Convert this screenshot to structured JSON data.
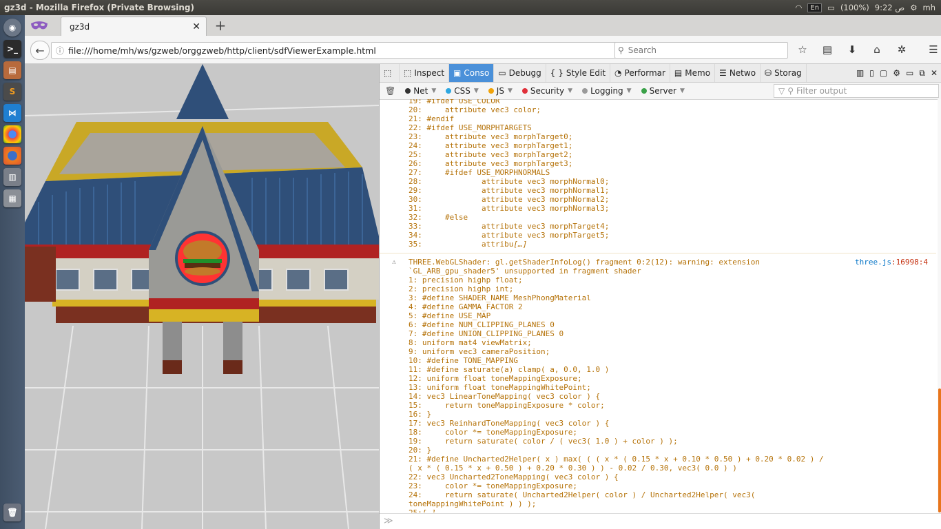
{
  "os": {
    "window_title": "gz3d - Mozilla Firefox (Private Browsing)",
    "tray": {
      "battery": "(100%)",
      "lang": "En",
      "time": "9:22 ص",
      "user": "mh"
    }
  },
  "launcher": {
    "items": [
      "dash",
      "terminal",
      "files",
      "sublime",
      "vscode",
      "chrome",
      "firefox",
      "text-editor",
      "settings",
      "trash"
    ]
  },
  "browser": {
    "tab_title": "gz3d",
    "url": "file:///home/mh/ws/gzweb/orggzweb/http/client/sdfViewerExample.html",
    "search_placeholder": "Search"
  },
  "devtools": {
    "tabs": [
      {
        "label": "Inspect",
        "icon": "⬚"
      },
      {
        "label": "Conso",
        "icon": "▣",
        "selected": true
      },
      {
        "label": "Debugg",
        "icon": "▭"
      },
      {
        "label": "Style Edit",
        "icon": "{ }"
      },
      {
        "label": "Performar",
        "icon": "◔"
      },
      {
        "label": "Memo",
        "icon": "▤"
      },
      {
        "label": "Netwo",
        "icon": "☰"
      },
      {
        "label": "Storag",
        "icon": "⛁"
      }
    ],
    "filters": [
      {
        "label": "Net",
        "color": "#333333"
      },
      {
        "label": "CSS",
        "color": "#2ea7e0"
      },
      {
        "label": "JS",
        "color": "#f0a30a"
      },
      {
        "label": "Security",
        "color": "#e0303a"
      },
      {
        "label": "Logging",
        "color": "#9a9a9a"
      },
      {
        "label": "Server",
        "color": "#3aa148"
      }
    ],
    "filter_placeholder": "Filter output",
    "console": {
      "first_block": [
        "19: #ifdef USE_COLOR",
        "20:     attribute vec3 color;",
        "21: #endif",
        "22: #ifdef USE_MORPHTARGETS",
        "23:     attribute vec3 morphTarget0;",
        "24:     attribute vec3 morphTarget1;",
        "25:     attribute vec3 morphTarget2;",
        "26:     attribute vec3 morphTarget3;",
        "27:     #ifdef USE_MORPHNORMALS",
        "28:             attribute vec3 morphNormal0;",
        "29:             attribute vec3 morphNormal1;",
        "30:             attribute vec3 morphNormal2;",
        "31:             attribute vec3 morphNormal3;",
        "32:     #else",
        "33:             attribute vec3 morphTarget4;",
        "34:             attribute vec3 morphTarget5;",
        "35:             attribu"
      ],
      "ellipsis": "[…]",
      "warning_source": "three.js",
      "warning_line": ":16998:4",
      "second_block": [
        "THREE.WebGLShader: gl.getShaderInfoLog() fragment 0:2(12): warning: extension",
        "`GL_ARB_gpu_shader5' unsupported in fragment shader",
        "1: precision highp float;",
        "2: precision highp int;",
        "3: #define SHADER_NAME MeshPhongMaterial",
        "4: #define GAMMA_FACTOR 2",
        "5: #define USE_MAP",
        "6: #define NUM_CLIPPING_PLANES 0",
        "7: #define UNION_CLIPPING_PLANES 0",
        "8: uniform mat4 viewMatrix;",
        "9: uniform vec3 cameraPosition;",
        "10: #define TONE_MAPPING",
        "11: #define saturate(a) clamp( a, 0.0, 1.0 )",
        "12: uniform float toneMappingExposure;",
        "13: uniform float toneMappingWhitePoint;",
        "14: vec3 LinearToneMapping( vec3 color ) {",
        "15:     return toneMappingExposure * color;",
        "16: }",
        "17: vec3 ReinhardToneMapping( vec3 color ) {",
        "18:     color *= toneMappingExposure;",
        "19:     return saturate( color / ( vec3( 1.0 ) + color ) );",
        "20: }",
        "21: #define Uncharted2Helper( x ) max( ( ( x * ( 0.15 * x + 0.10 * 0.50 ) + 0.20 * 0.02 ) /",
        "( x * ( 0.15 * x + 0.50 ) + 0.20 * 0.30 ) ) - 0.02 / 0.30, vec3( 0.0 ) )",
        "22: vec3 Uncharted2ToneMapping( vec3 color ) {",
        "23:     color *= toneMappingExposure;",
        "24:     return saturate( Uncharted2Helper( color ) / Uncharted2Helper( vec3(",
        "toneMappingWhitePoint ) ) );",
        "25:"
      ]
    },
    "cmd_prompt": "≫"
  }
}
